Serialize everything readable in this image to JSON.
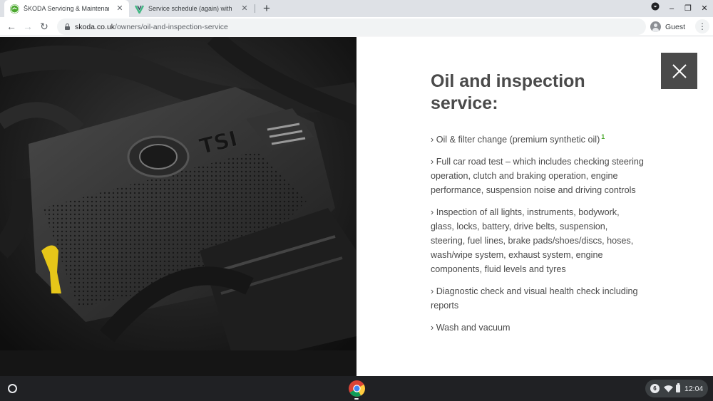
{
  "browser": {
    "tabs": [
      {
        "title": "ŠKODA Servicing & Maintenance",
        "favicon": "skoda-logo-icon",
        "active": true
      },
      {
        "title": "Service schedule (again) with Sk",
        "favicon": "vivaldi-v-icon",
        "active": false
      }
    ],
    "new_tab_label": "+",
    "window_controls": {
      "dropdown": "▾",
      "minimize": "–",
      "restore": "❐",
      "close": "✕"
    },
    "nav": {
      "back": "←",
      "forward": "→",
      "reload": "↻"
    },
    "url": {
      "host": "skoda.co.uk",
      "path": "/owners/oil-and-inspection-service"
    },
    "profile_label": "Guest",
    "menu_label": "⋮"
  },
  "panel": {
    "close_icon": "close-icon",
    "heading": "Oil and inspection service:",
    "items": [
      {
        "text": "› Oil & filter change (premium synthetic oil)",
        "footnote": "1"
      },
      {
        "text": "› Full car road test – which includes checking steering operation, clutch and braking operation, engine performance, suspension noise and driving controls"
      },
      {
        "text": "› Inspection of all lights, instruments, bodywork, glass, locks, battery, drive belts, suspension, steering, fuel lines, brake pads/shoes/discs, hoses, wash/wipe system, exhaust system, engine components, fluid levels and tyres"
      },
      {
        "text": "› Diagnostic check and visual health check including reports"
      },
      {
        "text": "› Wash and vacuum"
      }
    ]
  },
  "engine_image": {
    "cover_text": "TSI"
  },
  "taskbar": {
    "notification_count": "6",
    "time": "12:04"
  },
  "colors": {
    "accent_green": "#4ba82e",
    "text": "#4a4a4a",
    "close_bg": "#4a4a4a",
    "taskbar_bg": "#202124"
  }
}
